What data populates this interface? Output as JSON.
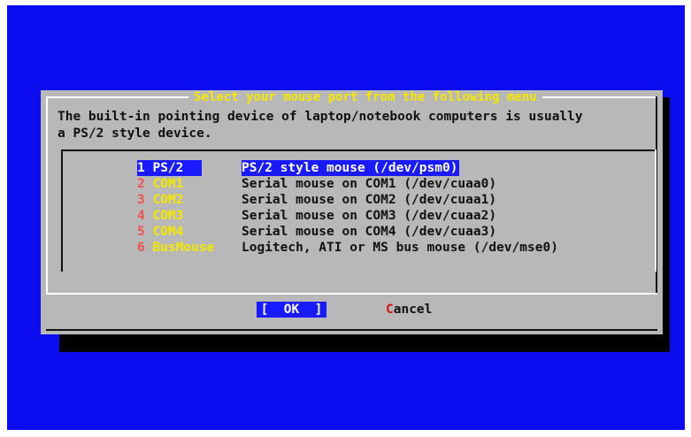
{
  "dialog": {
    "title": "Select your mouse port from the following menu",
    "prompt_lines": [
      "The built-in pointing device of laptop/notebook computers is usually",
      "a PS/2 style device."
    ]
  },
  "menu": {
    "items": [
      {
        "num": "1",
        "name": "PS/2",
        "desc": "PS/2 style mouse (/dev/psm0)"
      },
      {
        "num": "2",
        "name": "COM1",
        "desc": "Serial mouse on COM1 (/dev/cuaa0)"
      },
      {
        "num": "3",
        "name": "COM2",
        "desc": "Serial mouse on COM2 (/dev/cuaa1)"
      },
      {
        "num": "4",
        "name": "COM3",
        "desc": "Serial mouse on COM3 (/dev/cuaa2)"
      },
      {
        "num": "5",
        "name": "COM4",
        "desc": "Serial mouse on COM4 (/dev/cuaa3)"
      },
      {
        "num": "6",
        "name": "BusMouse",
        "desc": "Logitech, ATI or MS bus mouse (/dev/mse0)"
      }
    ]
  },
  "buttons": {
    "ok_label": "[  OK  ]",
    "cancel_hot": "C",
    "cancel_rest": "ancel"
  },
  "colors": {
    "screen_bg": "#0c0cf0",
    "dialog_bg": "#b8b8b8",
    "title": "#f5e800",
    "highlight": "#1a1aff",
    "hotkey": "#f05050"
  }
}
